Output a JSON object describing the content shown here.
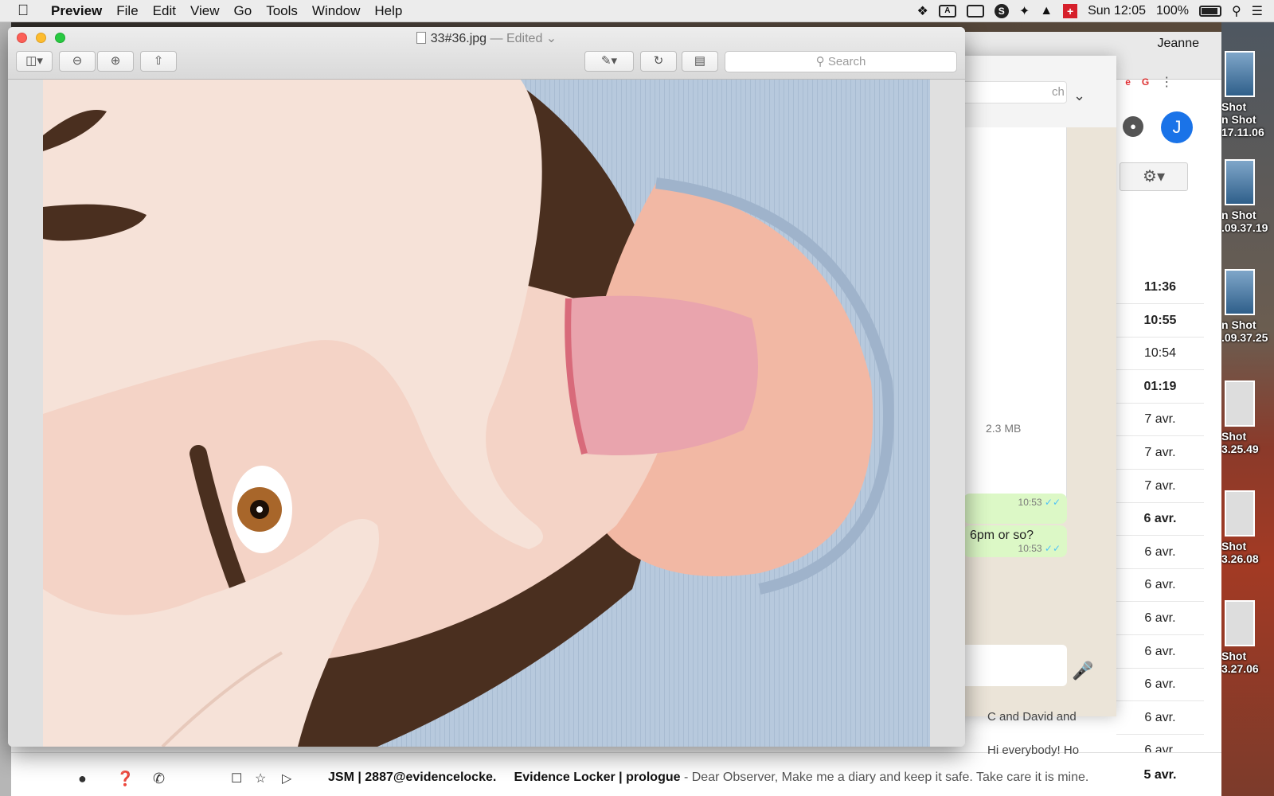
{
  "menubar": {
    "app_name": "Preview",
    "menus": [
      "File",
      "Edit",
      "View",
      "Go",
      "Tools",
      "Window",
      "Help"
    ],
    "clock": "Sun 12:05",
    "battery": "100%",
    "icons": [
      "dropbox-icon",
      "adobe-icon",
      "display-icon",
      "skype-icon",
      "bluetooth-icon",
      "wifi-icon",
      "flag-icon",
      "battery-icon",
      "spotlight-icon",
      "notification-center-icon"
    ]
  },
  "preview": {
    "filename": "33#36.jpg",
    "edited": "— Edited",
    "search_placeholder": "Search",
    "toolbar": [
      "sidebar-toggle",
      "zoom-out",
      "zoom-in",
      "share",
      "markup",
      "rotate",
      "toolbox"
    ]
  },
  "mail": {
    "user": "Jeanne",
    "avatar_letter": "J",
    "times": [
      {
        "label": "11:36",
        "bold": true
      },
      {
        "label": "10:55",
        "bold": true
      },
      {
        "label": "10:54",
        "bold": false
      },
      {
        "label": "01:19",
        "bold": true
      },
      {
        "label": "7 avr.",
        "bold": false
      },
      {
        "label": "7 avr.",
        "bold": false
      },
      {
        "label": "7 avr.",
        "bold": false
      },
      {
        "label": "6 avr.",
        "bold": true
      },
      {
        "label": "6 avr.",
        "bold": false
      },
      {
        "label": "6 avr.",
        "bold": false
      },
      {
        "label": "6 avr.",
        "bold": false
      },
      {
        "label": "6 avr.",
        "bold": false
      },
      {
        "label": "6 avr.",
        "bold": false
      },
      {
        "label": "6 avr.",
        "bold": false
      },
      {
        "label": "6 avr.",
        "bold": false
      }
    ],
    "bottom_row": {
      "sender": "JSM | 2887@evidencelocke.",
      "subject": "Evidence Locker | prologue",
      "snippet": " - Dear Observer, Make me a diary and keep it safe. Take care it is mine.",
      "date": "5 avr."
    },
    "snippet_1": "C and David and",
    "snippet_2": "Hi everybody! Ho"
  },
  "whatsapp": {
    "search_fragment": "ch",
    "file_size": "2.3 MB",
    "msg1_time": "10:53",
    "msg2_text": "6pm or so?",
    "msg2_time": "10:53"
  },
  "desktop_thumbs": [
    {
      "label": "Shot\nn Shot\n17.11.06"
    },
    {
      "label": "n Shot\n.09.37.19"
    },
    {
      "label": "n Shot\n.09.37.25"
    },
    {
      "label": "Shot\n3.25.49"
    },
    {
      "label": "Shot\n3.26.08"
    },
    {
      "label": "Shot\n3.27.06"
    }
  ]
}
